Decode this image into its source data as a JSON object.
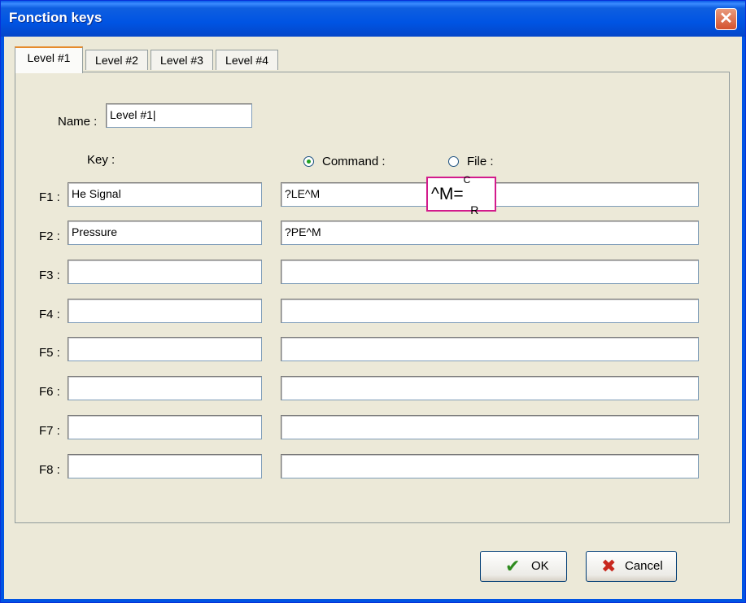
{
  "window": {
    "title": "Fonction keys",
    "close_glyph": "✕"
  },
  "tabs": [
    {
      "label": "Level #1",
      "active": true
    },
    {
      "label": "Level #2",
      "active": false
    },
    {
      "label": "Level #3",
      "active": false
    },
    {
      "label": "Level #4",
      "active": false
    }
  ],
  "name_field": {
    "label": "Name :",
    "value": "Level #1|"
  },
  "columns": {
    "key_label": "Key :"
  },
  "mode": {
    "options": [
      {
        "label": "Command :",
        "checked": true
      },
      {
        "label": "File :",
        "checked": false
      }
    ]
  },
  "rows": [
    {
      "label": "F1 :",
      "key": "He Signal",
      "command": "?LE^M"
    },
    {
      "label": "F2 :",
      "key": "Pressure",
      "command": "?PE^M"
    },
    {
      "label": "F3 :",
      "key": "",
      "command": ""
    },
    {
      "label": "F4 :",
      "key": "",
      "command": ""
    },
    {
      "label": "F5 :",
      "key": "",
      "command": ""
    },
    {
      "label": "F6 :",
      "key": "",
      "command": ""
    },
    {
      "label": "F7 :",
      "key": "",
      "command": ""
    },
    {
      "label": "F8 :",
      "key": "",
      "command": ""
    }
  ],
  "annotation": {
    "main": "^M=",
    "sup": "C",
    "sub": "R"
  },
  "buttons": {
    "ok": {
      "label": "OK",
      "icon": "check-icon",
      "glyph": "✔",
      "color": "#2e8b1e"
    },
    "cancel": {
      "label": "Cancel",
      "icon": "x-icon",
      "glyph": "✖",
      "color": "#c8281e"
    }
  }
}
